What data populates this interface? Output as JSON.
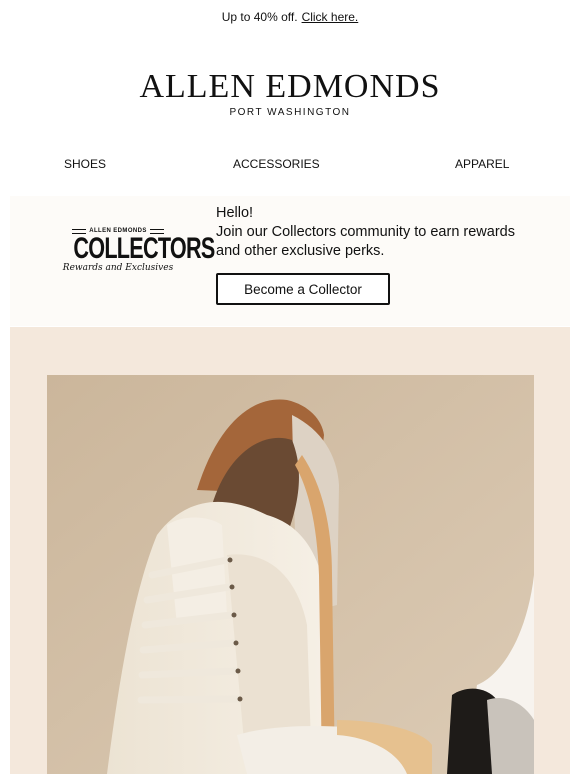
{
  "promo": {
    "text": "Up to 40% off.",
    "link": "Click here."
  },
  "brand": {
    "name": "ALLEN EDMONDS",
    "subtitle": "PORT WASHINGTON"
  },
  "nav": {
    "items": [
      "SHOES",
      "ACCESSORIES",
      "APPAREL"
    ]
  },
  "collectors": {
    "logo": {
      "top": "ALLEN EDMONDS",
      "main": "COLLECTORS",
      "tagline": "Rewards and Exclusives"
    },
    "greeting": "Hello!",
    "message": "Join our Collectors community to earn rewards and other exclusive perks.",
    "cta": "Become a Collector"
  },
  "hero": {
    "image": "white-leather-sneakers-photo"
  },
  "colors": {
    "panel": "#fdfbf8",
    "hero_bg": "#f4e8dc",
    "photo_bg": "#d2bfa6",
    "text": "#111111"
  }
}
